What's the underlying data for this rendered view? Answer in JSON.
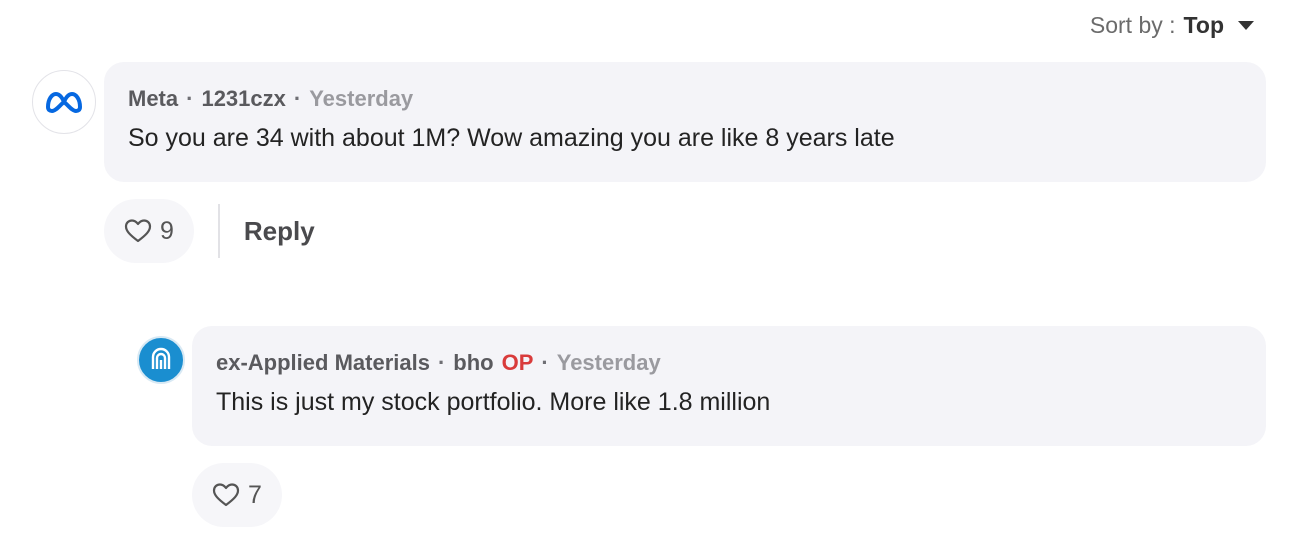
{
  "sort": {
    "label": "Sort by :",
    "value": "Top"
  },
  "comments": [
    {
      "author": "Meta",
      "username": "1231czx",
      "time": "Yesterday",
      "text": "So you are 34 with about 1M? Wow amazing you are like 8 years late",
      "likes": "9",
      "reply_label": "Reply",
      "avatar_icon": "meta-logo-icon",
      "avatar_color": "#0668E1"
    },
    {
      "author": "ex-Applied Materials",
      "username": "bho",
      "badge": "OP",
      "time": "Yesterday",
      "text": "This is just my stock portfolio. More like 1.8 million",
      "likes": "7",
      "avatar_icon": "applied-materials-logo-icon",
      "avatar_color": "#1a8ed0",
      "badge_color": "#d93b3b"
    }
  ]
}
